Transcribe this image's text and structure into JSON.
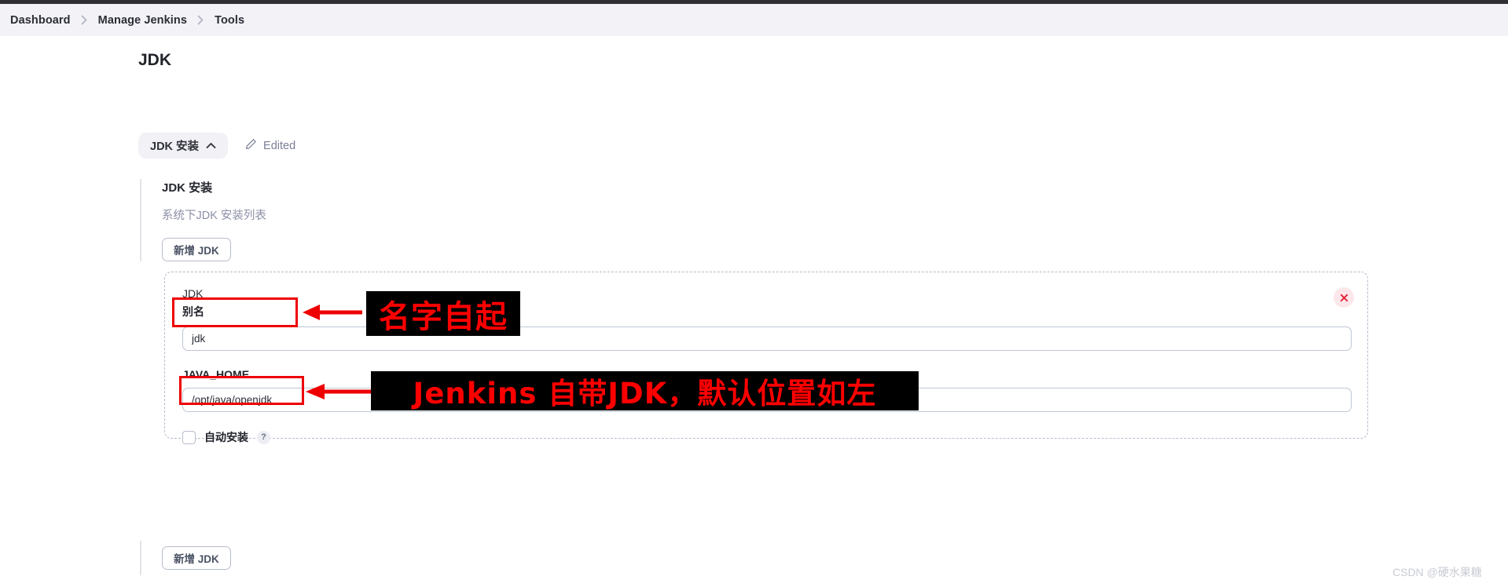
{
  "breadcrumb": {
    "items": [
      {
        "label": "Dashboard"
      },
      {
        "label": "Manage Jenkins"
      },
      {
        "label": "Tools"
      }
    ]
  },
  "page": {
    "title": "JDK"
  },
  "toolbar": {
    "chip_label": "JDK 安装",
    "chip_icon": "chevron-up-icon",
    "edited_label": "Edited",
    "edited_icon": "pencil-icon"
  },
  "section": {
    "title": "JDK 安装",
    "description": "系统下JDK 安装列表",
    "add_button_label": "新增 JDK"
  },
  "jdk_card": {
    "heading": "JDK",
    "alias": {
      "label": "别名",
      "value": "jdk",
      "placeholder": ""
    },
    "java_home": {
      "label": "JAVA_HOME",
      "value": "/opt/java/openjdk",
      "placeholder": ""
    },
    "auto_install": {
      "label": "自动安装",
      "checked": false,
      "help_label": "?",
      "help_icon": "question-icon"
    },
    "close_icon": "close-icon"
  },
  "footer": {
    "add_button_label": "新增 JDK"
  },
  "annotations": [
    {
      "text": "名字自起",
      "target": "alias-input"
    },
    {
      "text": "Jenkins 自带JDK，默认位置如左",
      "target": "java-home-input"
    }
  ],
  "watermark": {
    "text": "CSDN @硬水果糖"
  },
  "colors": {
    "annotation_red": "#ff0000",
    "annotation_bg": "#000000",
    "breadcrumb_bg": "#f3f2f7",
    "chip_bg": "#f1f1f6",
    "close_bg": "#fde7eb"
  }
}
